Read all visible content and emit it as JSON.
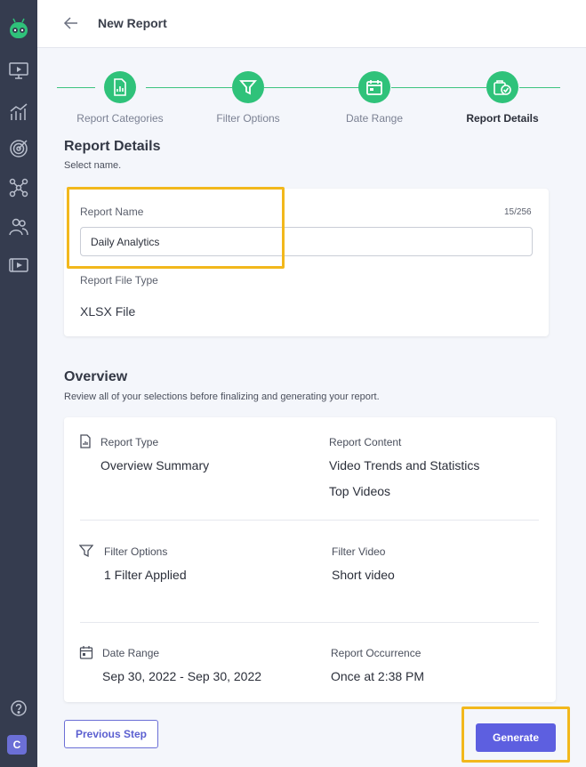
{
  "header": {
    "title": "New Report"
  },
  "sidebar": {
    "icons": [
      "app-logo-icon",
      "video-monitor-icon",
      "analytics-chart-icon",
      "target-icon",
      "network-icon",
      "users-icon",
      "video-library-icon",
      "help-icon"
    ],
    "user_initial": "C"
  },
  "stepper": {
    "steps": [
      {
        "label": "Report Categories",
        "icon": "report-doc-icon",
        "active": false
      },
      {
        "label": "Filter Options",
        "icon": "filter-icon",
        "active": false
      },
      {
        "label": "Date Range",
        "icon": "calendar-icon",
        "active": false
      },
      {
        "label": "Report Details",
        "icon": "report-check-icon",
        "active": true
      }
    ]
  },
  "report_details": {
    "title": "Report Details",
    "subtitle": "Select name.",
    "name_label": "Report Name",
    "name_value": "Daily Analytics",
    "char_count": "15/256",
    "file_type_label": "Report File Type",
    "file_type_value": "XLSX File"
  },
  "overview": {
    "title": "Overview",
    "subtitle": "Review all of your selections before finalizing and generating your report.",
    "report_type_label": "Report Type",
    "report_type_value": "Overview Summary",
    "report_content_label": "Report Content",
    "report_content_values": [
      "Video Trends and Statistics",
      "Top Videos"
    ],
    "filter_options_label": "Filter Options",
    "filter_options_value": "1 Filter Applied",
    "filter_video_label": "Filter Video",
    "filter_video_value": "Short video",
    "date_range_label": "Date Range",
    "date_range_value": "Sep 30, 2022 - Sep 30, 2022",
    "occurrence_label": "Report Occurrence",
    "occurrence_value": "Once at 2:38 PM"
  },
  "footer": {
    "previous_label": "Previous Step",
    "generate_label": "Generate"
  },
  "colors": {
    "accent": "#5d5fe0",
    "step_green": "#2fc27a",
    "highlight": "#f2b81c",
    "sidebar": "#353c4f"
  }
}
